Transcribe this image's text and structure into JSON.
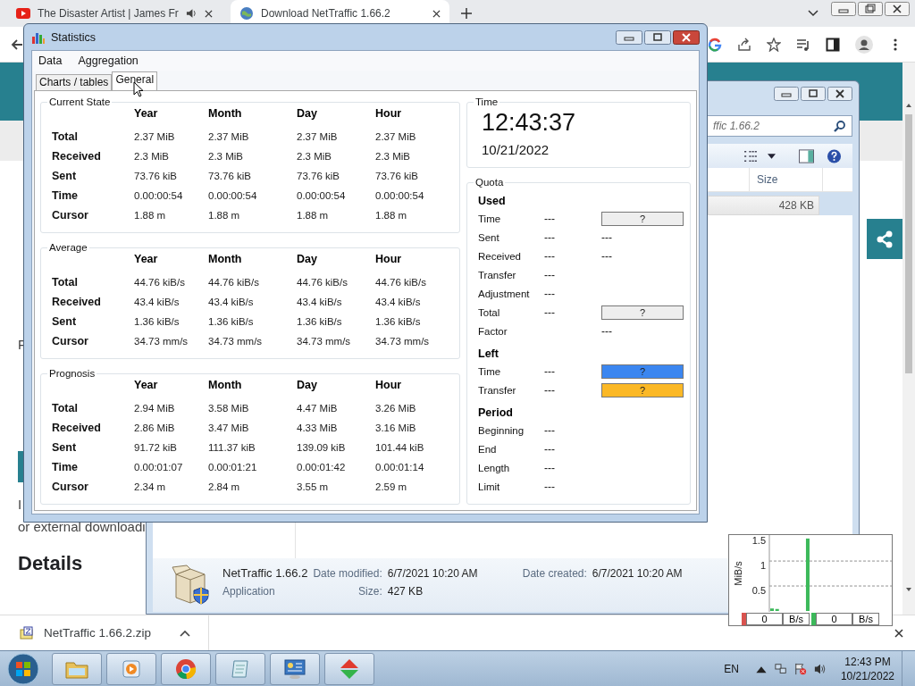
{
  "browser": {
    "tabs": [
      {
        "title": "The Disaster Artist | James Fr",
        "selected": false,
        "audio": true
      },
      {
        "title": "Download NetTraffic 1.66.2",
        "selected": true,
        "audio": false
      }
    ]
  },
  "page": {
    "blocks": [
      {
        "kind": "header"
      },
      {
        "kind": "band"
      },
      {
        "kind": "text",
        "text": "F"
      },
      {
        "kind": "button"
      },
      {
        "kind": "text",
        "text": "I"
      },
      {
        "kind": "text",
        "text": "or external downloadi"
      },
      {
        "kind": "heading",
        "text": "Details"
      }
    ]
  },
  "explorer": {
    "search": "ffic 1.66.2",
    "column": "Size",
    "file_size": "428 KB",
    "details": {
      "name": "NetTraffic 1.66.2",
      "type": "Application",
      "modified_label": "Date modified:",
      "modified": "6/7/2021 10:20 AM",
      "size_label": "Size:",
      "size": "427 KB",
      "created_label": "Date created:",
      "created": "6/7/2021 10:20 AM"
    }
  },
  "stats": {
    "title": "Statistics",
    "menu": [
      "Data",
      "Aggregation"
    ],
    "tabs": [
      {
        "label": "Charts / tables",
        "selected": false
      },
      {
        "label": "General",
        "selected": true
      }
    ],
    "groups": [
      {
        "title": "Current State",
        "columns": [
          "Year",
          "Month",
          "Day",
          "Hour"
        ],
        "rows": [
          {
            "label": "Total",
            "values": [
              "2.37 MiB",
              "2.37 MiB",
              "2.37 MiB",
              "2.37 MiB"
            ]
          },
          {
            "label": "Received",
            "values": [
              "2.3 MiB",
              "2.3 MiB",
              "2.3 MiB",
              "2.3 MiB"
            ]
          },
          {
            "label": "Sent",
            "values": [
              "73.76 kiB",
              "73.76 kiB",
              "73.76 kiB",
              "73.76 kiB"
            ]
          },
          {
            "label": "Time",
            "values": [
              "0.00:00:54",
              "0.00:00:54",
              "0.00:00:54",
              "0.00:00:54"
            ]
          },
          {
            "label": "Cursor",
            "values": [
              "1.88 m",
              "1.88 m",
              "1.88 m",
              "1.88 m"
            ]
          }
        ]
      },
      {
        "title": "Average",
        "columns": [
          "Year",
          "Month",
          "Day",
          "Hour"
        ],
        "rows": [
          {
            "label": "Total",
            "values": [
              "44.76 kiB/s",
              "44.76 kiB/s",
              "44.76 kiB/s",
              "44.76 kiB/s"
            ]
          },
          {
            "label": "Received",
            "values": [
              "43.4 kiB/s",
              "43.4 kiB/s",
              "43.4 kiB/s",
              "43.4 kiB/s"
            ]
          },
          {
            "label": "Sent",
            "values": [
              "1.36 kiB/s",
              "1.36 kiB/s",
              "1.36 kiB/s",
              "1.36 kiB/s"
            ]
          },
          {
            "label": "Cursor",
            "values": [
              "34.73 mm/s",
              "34.73 mm/s",
              "34.73 mm/s",
              "34.73 mm/s"
            ]
          }
        ]
      },
      {
        "title": "Prognosis",
        "columns": [
          "Year",
          "Month",
          "Day",
          "Hour"
        ],
        "rows": [
          {
            "label": "Total",
            "values": [
              "2.94 MiB",
              "3.58 MiB",
              "4.47 MiB",
              "3.26 MiB"
            ]
          },
          {
            "label": "Received",
            "values": [
              "2.86 MiB",
              "3.47 MiB",
              "4.33 MiB",
              "3.16 MiB"
            ]
          },
          {
            "label": "Sent",
            "values": [
              "91.72 kiB",
              "111.37 kiB",
              "139.09 kiB",
              "101.44 kiB"
            ]
          },
          {
            "label": "Time",
            "values": [
              "0.00:01:07",
              "0.00:01:21",
              "0.00:01:42",
              "0.00:01:14"
            ]
          },
          {
            "label": "Cursor",
            "values": [
              "2.34 m",
              "2.84 m",
              "3.55 m",
              "2.59 m"
            ]
          }
        ]
      }
    ],
    "time": {
      "title": "Time",
      "clock": "12:43:37",
      "date": "10/21/2022"
    },
    "quota": {
      "title": "Quota",
      "sections": [
        {
          "title": "Used",
          "rows": [
            {
              "label": "Time",
              "value": "---",
              "bar": {
                "text": "?",
                "color": "#eeeeee"
              }
            },
            {
              "label": "Sent",
              "value": "---",
              "value2": "---"
            },
            {
              "label": "Received",
              "value": "---",
              "value2": "---"
            },
            {
              "label": "Transfer",
              "value": "---"
            },
            {
              "label": "Adjustment",
              "value": "---"
            },
            {
              "label": "Total",
              "value": "---",
              "bar": {
                "text": "?",
                "color": "#eeeeee"
              }
            },
            {
              "label": "Factor",
              "value2": "---"
            }
          ]
        },
        {
          "title": "Left",
          "rows": [
            {
              "label": "Time",
              "value": "---",
              "bar": {
                "text": "?",
                "color": "#3b86f0"
              }
            },
            {
              "label": "Transfer",
              "value": "---",
              "bar": {
                "text": "?",
                "color": "#fbb826"
              }
            }
          ]
        },
        {
          "title": "Period",
          "rows": [
            {
              "label": "Beginning",
              "value": "---"
            },
            {
              "label": "End",
              "value": "---"
            },
            {
              "label": "Length",
              "value": "---"
            },
            {
              "label": "Limit",
              "value": "---"
            }
          ]
        }
      ]
    }
  },
  "meter": {
    "chart_data": {
      "type": "bar",
      "ylabel": "MiB/s",
      "ylim": [
        0,
        1.52
      ],
      "yticks": [
        0.5,
        1,
        1.5
      ],
      "series": [
        {
          "color": "#3cb95a",
          "values": [
            0.05,
            0.04,
            0,
            0,
            0,
            0,
            0,
            1.45,
            0,
            0,
            0,
            0,
            0,
            0,
            0,
            0,
            0,
            0,
            0,
            0,
            0,
            0,
            0,
            0
          ]
        }
      ]
    },
    "readouts": [
      {
        "value": "0",
        "unit": "B/s",
        "color": "#d9534f"
      },
      {
        "value": "0",
        "unit": "B/s",
        "color": "#3cb95a"
      }
    ]
  },
  "downloads": {
    "file": "NetTraffic 1.66.2.zip"
  },
  "taskbar": {
    "language": "EN",
    "time": "12:43 PM",
    "date": "10/21/2022"
  }
}
